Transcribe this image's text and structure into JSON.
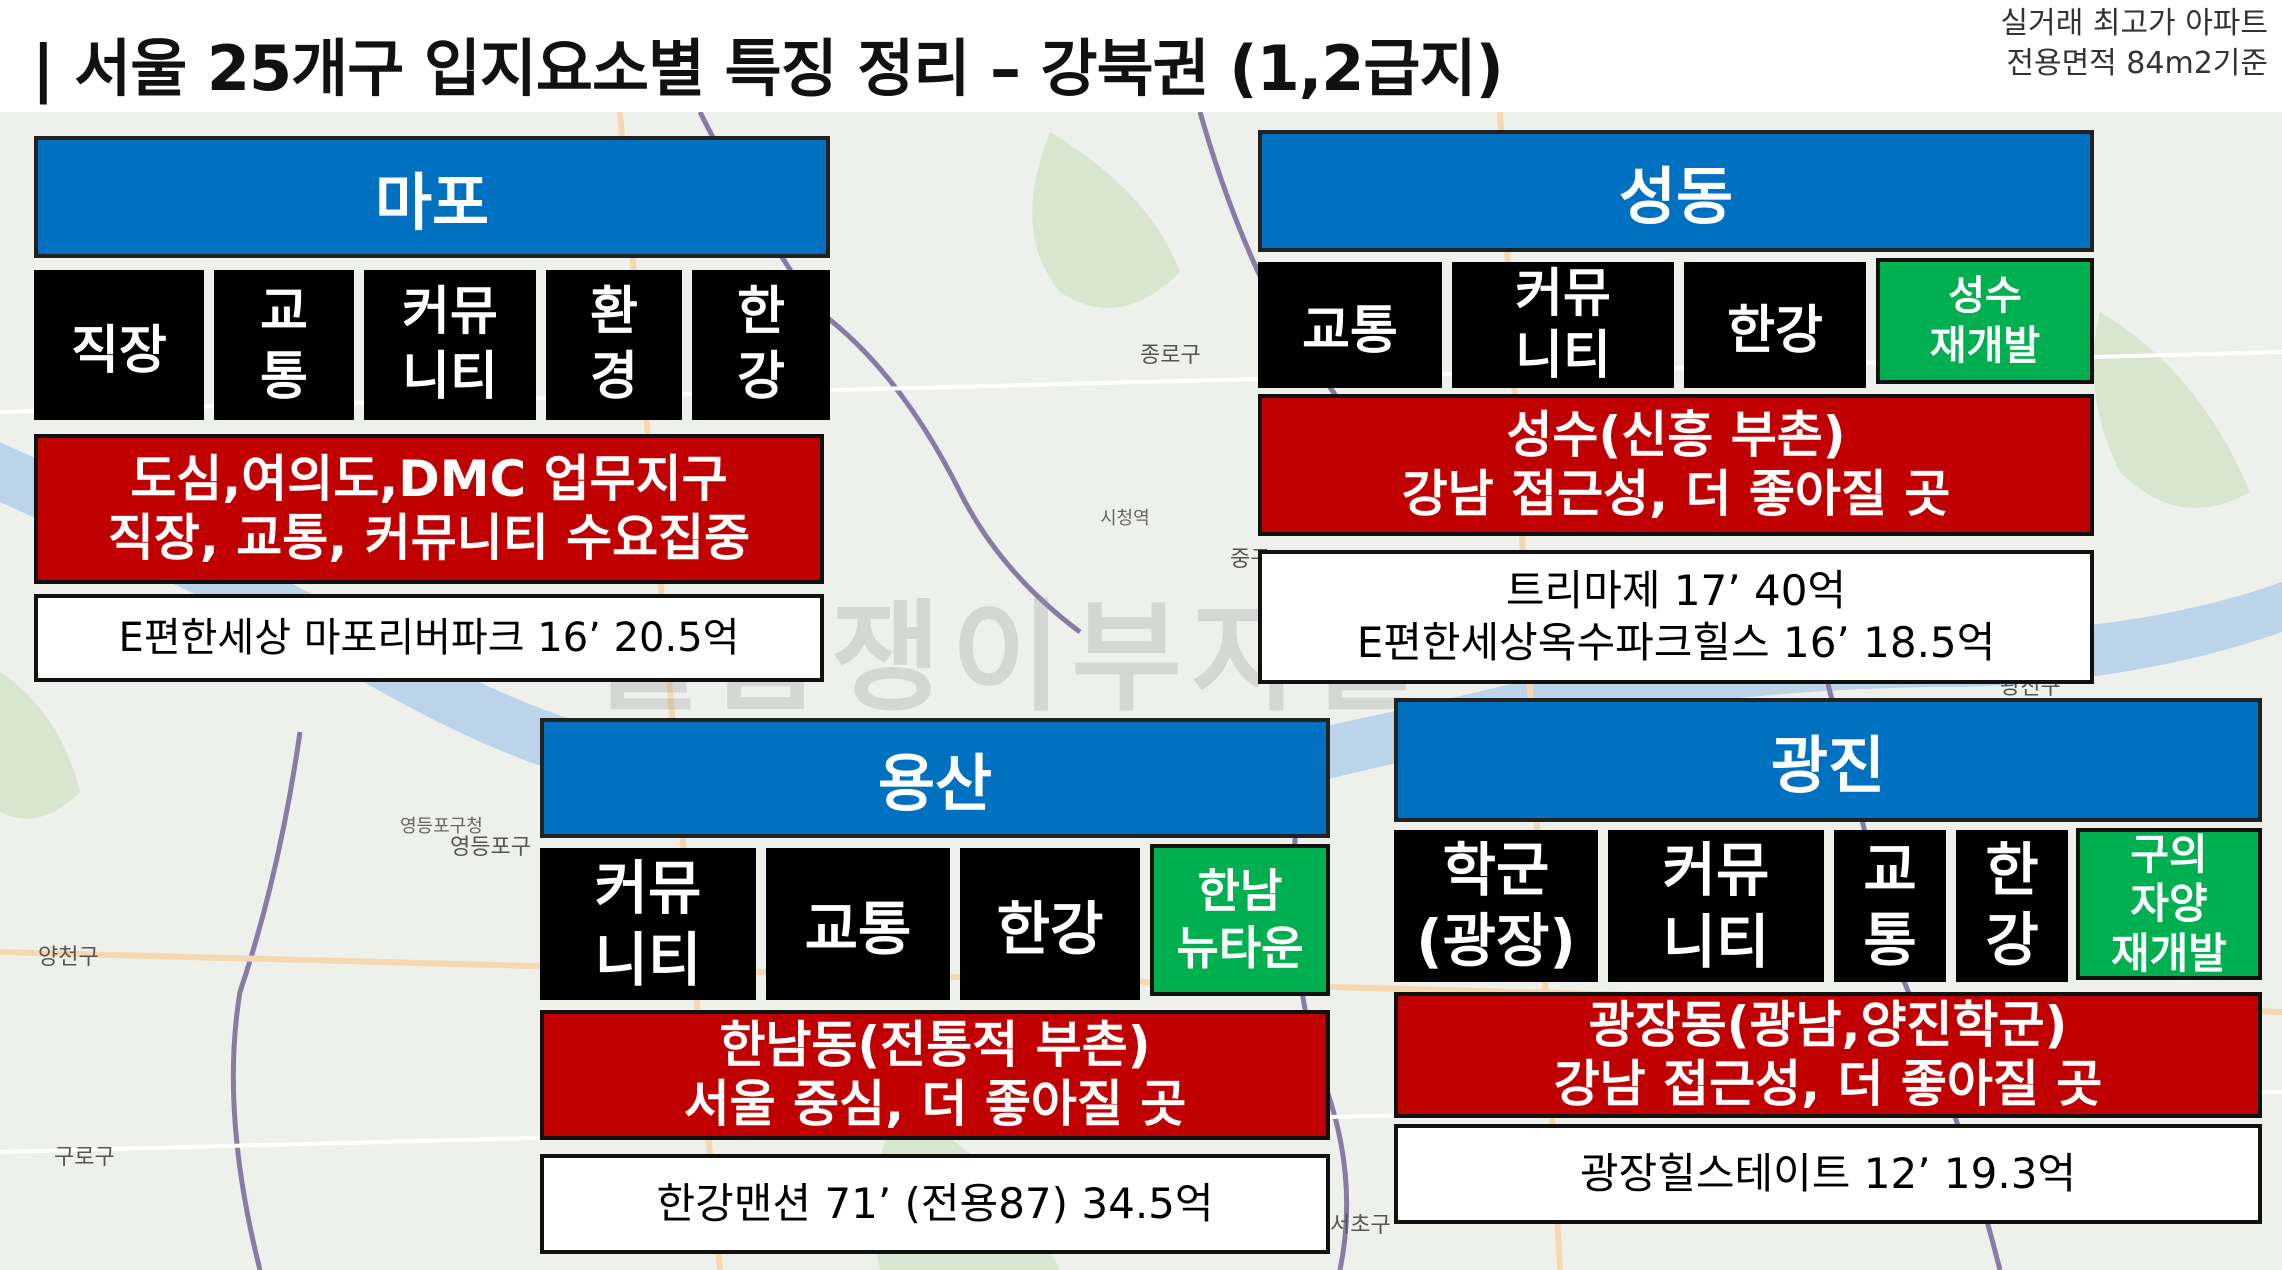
{
  "header": {
    "title": "| 서울 25개구 입지요소별 특징 정리 – 강북권 (1,2급지)",
    "note_line1": "실거래 최고가 아파트",
    "note_line2": "전용면적 84m2기준"
  },
  "map_labels": [
    "종로구",
    "영등포구",
    "양천구",
    "구로구",
    "서초구",
    "광진구",
    "영등포구청",
    "시청역",
    "중구"
  ],
  "watermark": "월급쟁이부자들",
  "districts": {
    "mapo": {
      "name": "마포",
      "tags": [
        "직장",
        "교\n통",
        "커뮤\n니티",
        "환\n경",
        "한\n강"
      ],
      "desc_line1": "도심,여의도,DMC 업무지구",
      "desc_line2": "직장, 교통, 커뮤니티 수요집중",
      "apt": "E편한세상 마포리버파크  16’ 20.5억"
    },
    "seongdong": {
      "name": "성동",
      "tags": [
        "교통",
        "커뮤\n니티",
        "한강"
      ],
      "highlight": "성수\n재개발",
      "desc_line1": "성수(신흥 부촌)",
      "desc_line2": "강남 접근성, 더 좋아질 곳",
      "apt_line1": "트리마제  17’ 40억",
      "apt_line2": "E편한세상옥수파크힐스 16’ 18.5억"
    },
    "yongsan": {
      "name": "용산",
      "tags": [
        "커뮤\n니티",
        "교통",
        "한강"
      ],
      "highlight": "한남\n뉴타운",
      "desc_line1": "한남동(전통적 부촌)",
      "desc_line2": "서울 중심, 더 좋아질 곳",
      "apt": "한강맨션  71’ (전용87)  34.5억"
    },
    "gwangjin": {
      "name": "광진",
      "tags": [
        "학군\n(광장)",
        "커뮤\n니티",
        "교\n통",
        "한\n강"
      ],
      "highlight": "구의\n자양\n재개발",
      "desc_line1": "광장동(광남,양진학군)",
      "desc_line2": "강남 접근성, 더 좋아질 곳",
      "apt": "광장힐스테이트  12’ 19.3억"
    }
  },
  "colors": {
    "title_blue": "#0070c0",
    "tag_black": "#000000",
    "highlight_green": "#00b050",
    "desc_red": "#c00000"
  }
}
